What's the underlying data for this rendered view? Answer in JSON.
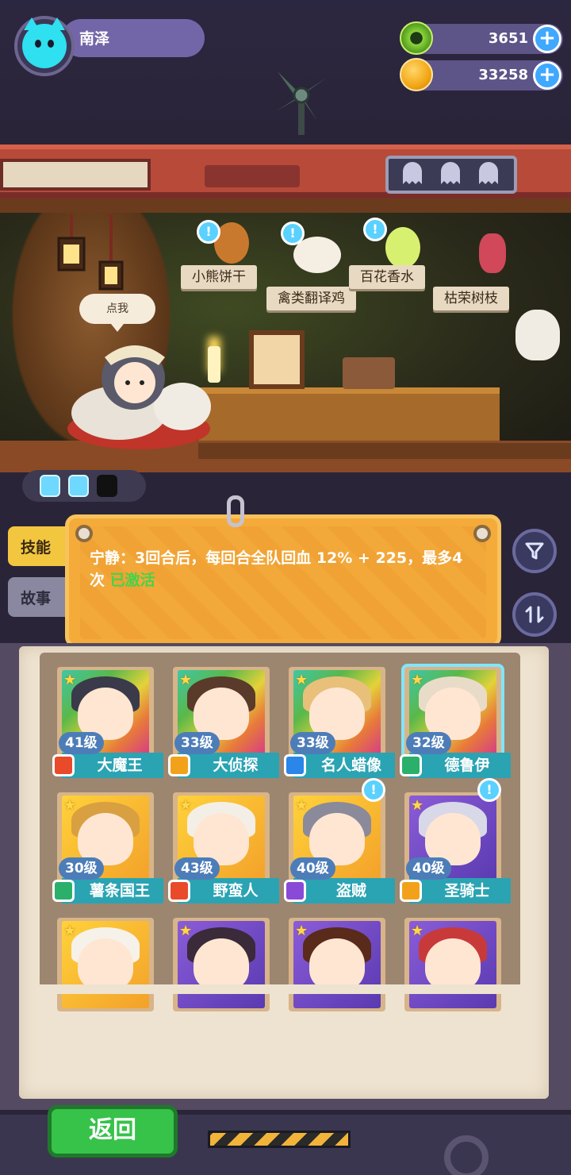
{
  "player": {
    "name": "南泽"
  },
  "currencies": [
    {
      "icon": "green-gem-icon",
      "value": "3651"
    },
    {
      "icon": "gold-coin-icon",
      "value": "33258"
    }
  ],
  "shop": {
    "items": [
      "小熊饼干",
      "禽类翻译鸡",
      "百花香水",
      "枯荣树枝"
    ],
    "speech_bubble": "点我"
  },
  "energy": {
    "filled": 2,
    "total": 3
  },
  "side_tabs": {
    "skill": "技能",
    "story": "故事"
  },
  "skill_info": {
    "description": "宁静：3回合后，每回合全队回血 12% + 225，最多4次",
    "status": "已激活"
  },
  "characters": [
    {
      "level": "41级",
      "name": "大魔王",
      "class_color": "#e84a2a",
      "alert": false,
      "frame": "rainbow"
    },
    {
      "level": "33级",
      "name": "大侦探",
      "class_color": "#f2a21a",
      "alert": false,
      "frame": "rainbow"
    },
    {
      "level": "33级",
      "name": "名人蜡像",
      "class_color": "#2a86e8",
      "alert": false,
      "frame": "rainbow"
    },
    {
      "level": "32级",
      "name": "德鲁伊",
      "class_color": "#2ab06a",
      "alert": false,
      "frame": "rainbow",
      "selected": true
    },
    {
      "level": "30级",
      "name": "薯条国王",
      "class_color": "#2ab06a",
      "alert": false,
      "frame": "gold"
    },
    {
      "level": "43级",
      "name": "野蛮人",
      "class_color": "#e84a2a",
      "alert": false,
      "frame": "gold"
    },
    {
      "level": "40级",
      "name": "盗贼",
      "class_color": "#8a4ad8",
      "alert": true,
      "frame": "gold"
    },
    {
      "level": "40级",
      "name": "圣骑士",
      "class_color": "#f2a21a",
      "alert": true,
      "frame": "purple"
    },
    {
      "level": "",
      "name": "",
      "class_color": "#f2a21a",
      "alert": false,
      "frame": "gold"
    },
    {
      "level": "",
      "name": "",
      "class_color": "#8a4ad8",
      "alert": false,
      "frame": "purple"
    },
    {
      "level": "",
      "name": "",
      "class_color": "#e84a2a",
      "alert": false,
      "frame": "purple"
    },
    {
      "level": "",
      "name": "",
      "class_color": "#e84a2a",
      "alert": false,
      "frame": "purple"
    }
  ],
  "bottom": {
    "back_label": "返回"
  },
  "colors": {
    "accent_orange": "#f4ab3a",
    "active_green": "#45d34a",
    "back_green": "#37c24a"
  }
}
